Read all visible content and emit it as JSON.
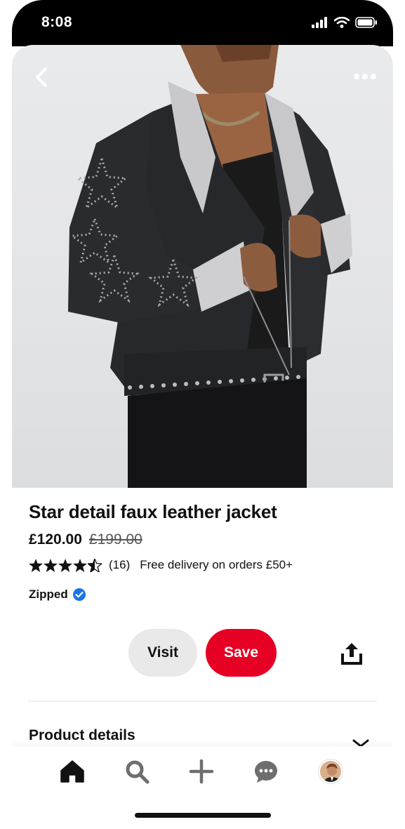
{
  "status_bar": {
    "time": "8:08"
  },
  "product": {
    "title": "Star detail faux leather jacket",
    "price": "£120.00",
    "original_price": "£199.00",
    "rating": 4.5,
    "review_count": "(16)",
    "delivery_note": "Free delivery on orders £50+",
    "brand": "Zipped"
  },
  "actions": {
    "visit_label": "Visit",
    "save_label": "Save"
  },
  "sections": {
    "details_title": "Product details"
  },
  "icons": {
    "back": "chevron-left-icon",
    "more": "more-horizontal-icon",
    "share": "share-upload-icon",
    "verified": "verified-badge-icon",
    "nav": [
      "home-icon",
      "search-icon",
      "plus-icon",
      "chat-icon",
      "avatar"
    ]
  },
  "colors": {
    "accent": "#e60023",
    "visit_bg": "#e9e9e9",
    "verified": "#1a73e8"
  }
}
